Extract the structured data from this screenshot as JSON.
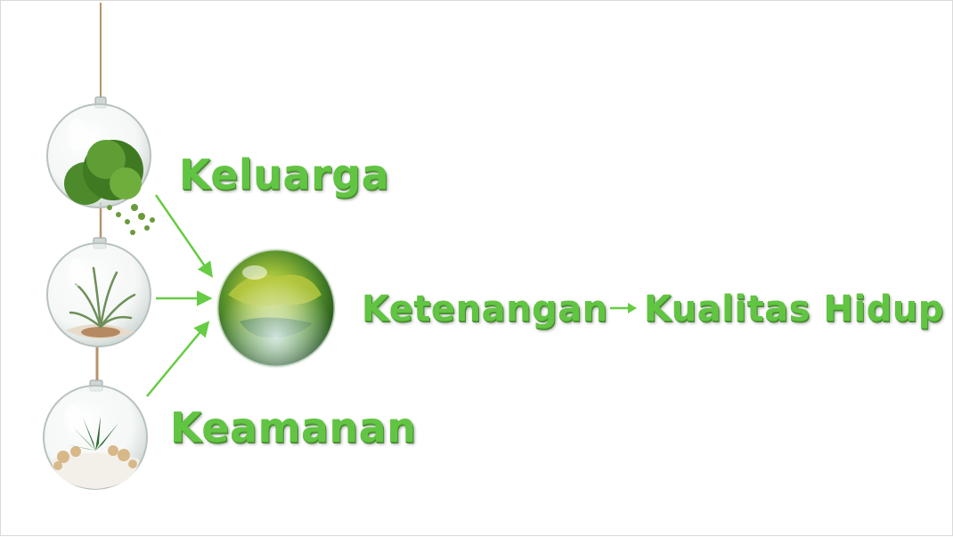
{
  "labels": {
    "keluarga": "Keluarga",
    "keamanan": "Keamanan",
    "ketenangan": "Ketenangan",
    "kualitas_hidup": "Kualitas Hidup"
  },
  "colors": {
    "text_green": "#62c443",
    "arrow_green": "#66cc44",
    "moss_dark": "#3f7a22",
    "moss_light": "#6fae3c",
    "twine": "#b8926a"
  }
}
